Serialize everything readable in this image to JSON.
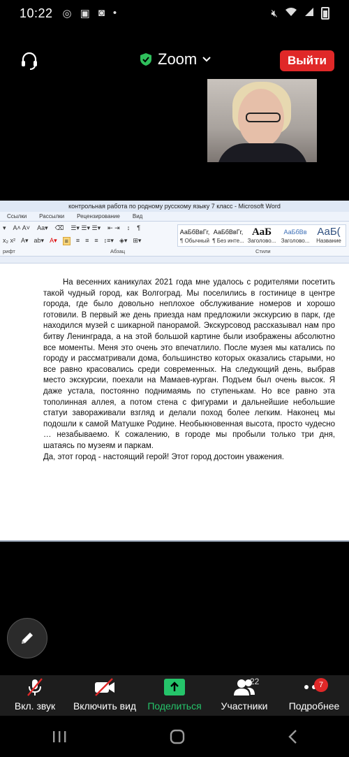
{
  "status": {
    "time": "10:22"
  },
  "header": {
    "title": "Zoom",
    "leave_label": "Выйти"
  },
  "word": {
    "window_title": "контрольная работа по родному русскому языку 7 класс  -  Microsoft Word",
    "tabs": [
      "Ссылки",
      "Рассылки",
      "Рецензирование",
      "Вид"
    ],
    "styles": [
      {
        "sample": "АаБбВвГг,",
        "label": "¶ Обычный"
      },
      {
        "sample": "АаБбВвГг,",
        "label": "¶ Без инте..."
      },
      {
        "sample": "АаБ",
        "label": "Заголово..."
      },
      {
        "sample": "АаБбВв",
        "label": "Заголово..."
      },
      {
        "sample": "АаБ(",
        "label": "Название"
      }
    ],
    "groups": {
      "font": "рифт",
      "paragraph": "Абзац",
      "styles": "Стили"
    }
  },
  "document": {
    "paragraph_1": "На весенних каникулах 2021 года мне удалось с родителями посетить такой чудный город, как Волгоград. Мы поселились в гостинице в центре города, где было довольно неплохое обслуживание номеров и хорошо готовили. В первый же день приезда нам предложили экскурсию в парк, где находился музей с шикарной панорамой. Экскурсовод рассказывал нам про битву Ленинграда, а на этой большой картине были изображены абсолютно все моменты. Меня это очень это впечатлило. После музея мы катались по городу и рассматривали дома, большинство которых оказались старыми, но все равно красовались среди современных. На следующий день, выбрав место экскурсии, поехали на Мамаев-курган. Подъем был очень высок. Я даже устала, постоянно поднимаямь по ступенькам. Но все равно эта тополинная аллея, а потом стена с фигурами и дальнейшие небольшие статуи завораживали взгляд и делали поход более легким. Наконец мы подошли к самой Матушке Родине. Необыкновенная высота, просто чудесно … незабываемо. К сожалению, в городе мы пробыли только три дня, шатаясь по музеям и паркам.",
    "paragraph_2": "Да, этот город - настоящий герой! Этот город достоин уважения."
  },
  "toolbar": {
    "audio_label": "Вкл. звук",
    "video_label": "Включить вид",
    "share_label": "Поделиться",
    "participants_label": "Участники",
    "participants_count": "22",
    "more_label": "Подробнее",
    "more_badge": "7"
  },
  "colors": {
    "leave": "#e02828",
    "share": "#25c46a",
    "shield": "#2fbf5c"
  }
}
